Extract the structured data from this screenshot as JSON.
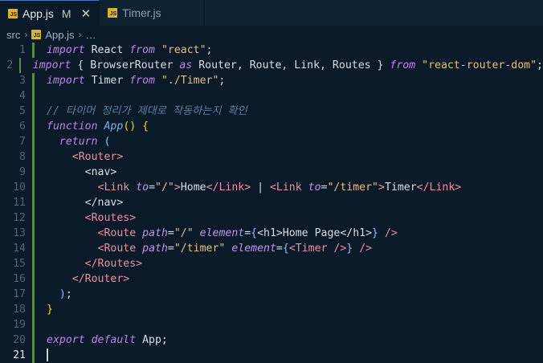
{
  "tabs": [
    {
      "icon_text": "JS",
      "label": "App.js",
      "modified": "M",
      "close": "✕"
    },
    {
      "icon_text": "JS",
      "label": "Timer.js"
    }
  ],
  "breadcrumbs": {
    "folder": "src",
    "file": "App.js",
    "more": "…",
    "sep": "›"
  },
  "lines": [
    {
      "num": "1",
      "tokens": [
        [
          "kw",
          "import"
        ],
        [
          "plain",
          " React "
        ],
        [
          "kw",
          "from"
        ],
        [
          "plain",
          " "
        ],
        [
          "str",
          "\"react\""
        ],
        [
          "plain",
          ";"
        ]
      ]
    },
    {
      "num": "2",
      "tokens": [
        [
          "kw",
          "import"
        ],
        [
          "plain",
          " { BrowserRouter "
        ],
        [
          "kw",
          "as"
        ],
        [
          "plain",
          " Router, Route, Link, Routes } "
        ],
        [
          "kw",
          "from"
        ],
        [
          "plain",
          " "
        ],
        [
          "str",
          "\"react-router-dom\""
        ],
        [
          "plain",
          ";"
        ]
      ]
    },
    {
      "num": "3",
      "tokens": [
        [
          "kw",
          "import"
        ],
        [
          "plain",
          " Timer "
        ],
        [
          "kw",
          "from"
        ],
        [
          "plain",
          " "
        ],
        [
          "str",
          "\"./Timer\""
        ],
        [
          "plain",
          ";"
        ]
      ]
    },
    {
      "num": "4",
      "tokens": []
    },
    {
      "num": "5",
      "tokens": [
        [
          "cmt",
          "// 타이머 정리가 제대로 작동하는지 확인"
        ]
      ]
    },
    {
      "num": "6",
      "tokens": [
        [
          "kw",
          "function"
        ],
        [
          "plain",
          " "
        ],
        [
          "fn",
          "App"
        ],
        [
          "paren",
          "()"
        ],
        [
          "plain",
          " "
        ],
        [
          "paren",
          "{"
        ]
      ]
    },
    {
      "num": "7",
      "tokens": [
        [
          "plain",
          "  "
        ],
        [
          "kw",
          "return"
        ],
        [
          "plain",
          " "
        ],
        [
          "brace",
          "("
        ]
      ]
    },
    {
      "num": "8",
      "tokens": [
        [
          "plain",
          "    "
        ],
        [
          "tag",
          "<Router>"
        ]
      ]
    },
    {
      "num": "9",
      "tokens": [
        [
          "plain",
          "      "
        ],
        [
          "plain",
          "<nav>"
        ]
      ]
    },
    {
      "num": "10",
      "tokens": [
        [
          "plain",
          "        "
        ],
        [
          "tag",
          "<Link"
        ],
        [
          "plain",
          " "
        ],
        [
          "attr",
          "to"
        ],
        [
          "plain",
          "="
        ],
        [
          "str",
          "\"/\""
        ],
        [
          "tag",
          ">"
        ],
        [
          "plain",
          "Home"
        ],
        [
          "tag",
          "</Link>"
        ],
        [
          "plain",
          " | "
        ],
        [
          "tag",
          "<Link"
        ],
        [
          "plain",
          " "
        ],
        [
          "attr",
          "to"
        ],
        [
          "plain",
          "="
        ],
        [
          "str",
          "\"/timer\""
        ],
        [
          "tag",
          ">"
        ],
        [
          "plain",
          "Timer"
        ],
        [
          "tag",
          "</Link>"
        ]
      ]
    },
    {
      "num": "11",
      "tokens": [
        [
          "plain",
          "      </nav>"
        ]
      ]
    },
    {
      "num": "12",
      "tokens": [
        [
          "plain",
          "      "
        ],
        [
          "tag",
          "<Routes>"
        ]
      ]
    },
    {
      "num": "13",
      "tokens": [
        [
          "plain",
          "        "
        ],
        [
          "tag",
          "<Route"
        ],
        [
          "plain",
          " "
        ],
        [
          "attr",
          "path"
        ],
        [
          "plain",
          "="
        ],
        [
          "str",
          "\"/\""
        ],
        [
          "plain",
          " "
        ],
        [
          "attr",
          "element"
        ],
        [
          "plain",
          "="
        ],
        [
          "brace",
          "{"
        ],
        [
          "plain",
          "<h1>Home Page</h1>"
        ],
        [
          "brace",
          "}"
        ],
        [
          "plain",
          " "
        ],
        [
          "tag",
          "/>"
        ]
      ]
    },
    {
      "num": "14",
      "tokens": [
        [
          "plain",
          "        "
        ],
        [
          "tag",
          "<Route"
        ],
        [
          "plain",
          " "
        ],
        [
          "attr",
          "path"
        ],
        [
          "plain",
          "="
        ],
        [
          "str",
          "\"/timer\""
        ],
        [
          "plain",
          " "
        ],
        [
          "attr",
          "element"
        ],
        [
          "plain",
          "="
        ],
        [
          "brace",
          "{"
        ],
        [
          "tag",
          "<Timer />"
        ],
        [
          "brace",
          "}"
        ],
        [
          "plain",
          " "
        ],
        [
          "tag",
          "/>"
        ]
      ]
    },
    {
      "num": "15",
      "tokens": [
        [
          "plain",
          "      "
        ],
        [
          "tag",
          "</Routes>"
        ]
      ]
    },
    {
      "num": "16",
      "tokens": [
        [
          "plain",
          "    "
        ],
        [
          "tag",
          "</Router>"
        ]
      ]
    },
    {
      "num": "17",
      "tokens": [
        [
          "plain",
          "  "
        ],
        [
          "brace",
          ")"
        ],
        [
          "plain",
          ";"
        ]
      ]
    },
    {
      "num": "18",
      "tokens": [
        [
          "paren",
          "}"
        ]
      ]
    },
    {
      "num": "19",
      "tokens": []
    },
    {
      "num": "20",
      "tokens": [
        [
          "kw",
          "export"
        ],
        [
          "plain",
          " "
        ],
        [
          "kw",
          "default"
        ],
        [
          "plain",
          " App;"
        ]
      ]
    },
    {
      "num": "21",
      "tokens": [],
      "current": true,
      "cursor": true
    }
  ]
}
